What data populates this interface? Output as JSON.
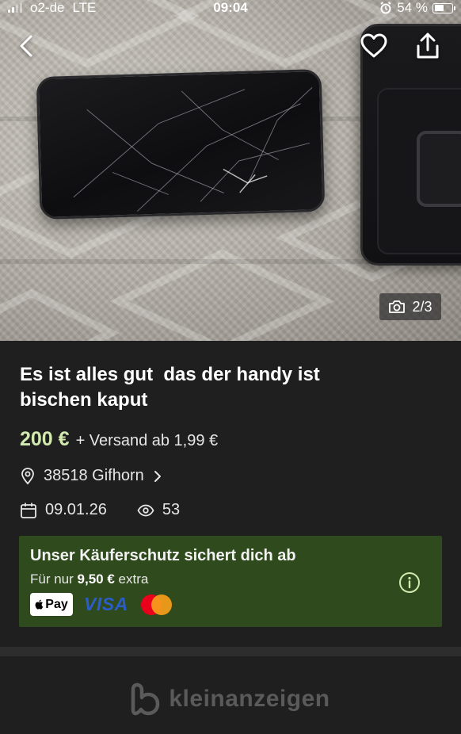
{
  "status_bar": {
    "carrier": "o2-de",
    "network": "LTE",
    "time": "09:04",
    "battery": "54 %",
    "battery_level": 0.54
  },
  "gallery": {
    "counter": "2/3",
    "current_image": 2,
    "total_images": 3
  },
  "listing": {
    "title": "Es ist alles gut  das der handy ist\nbischen kaput",
    "price": "200 €",
    "shipping": "+ Versand ab 1,99 €",
    "location": "38518 Gifhorn",
    "date": "09.01.26",
    "views": "53"
  },
  "buyer_protection": {
    "title": "Unser Käuferschutz sichert dich ab",
    "prefix": "Für nur ",
    "amount": "9,50 €",
    "suffix": " extra",
    "payment_methods": [
      "Pay",
      "VISA",
      "Mastercard"
    ]
  },
  "footer": {
    "brand": "kleinanzeigen"
  },
  "colors": {
    "background": "#1f1f1f",
    "price_accent": "#d2eab0",
    "protection_bg": "#2f4a1c",
    "info_icon": "#d2eab0"
  }
}
